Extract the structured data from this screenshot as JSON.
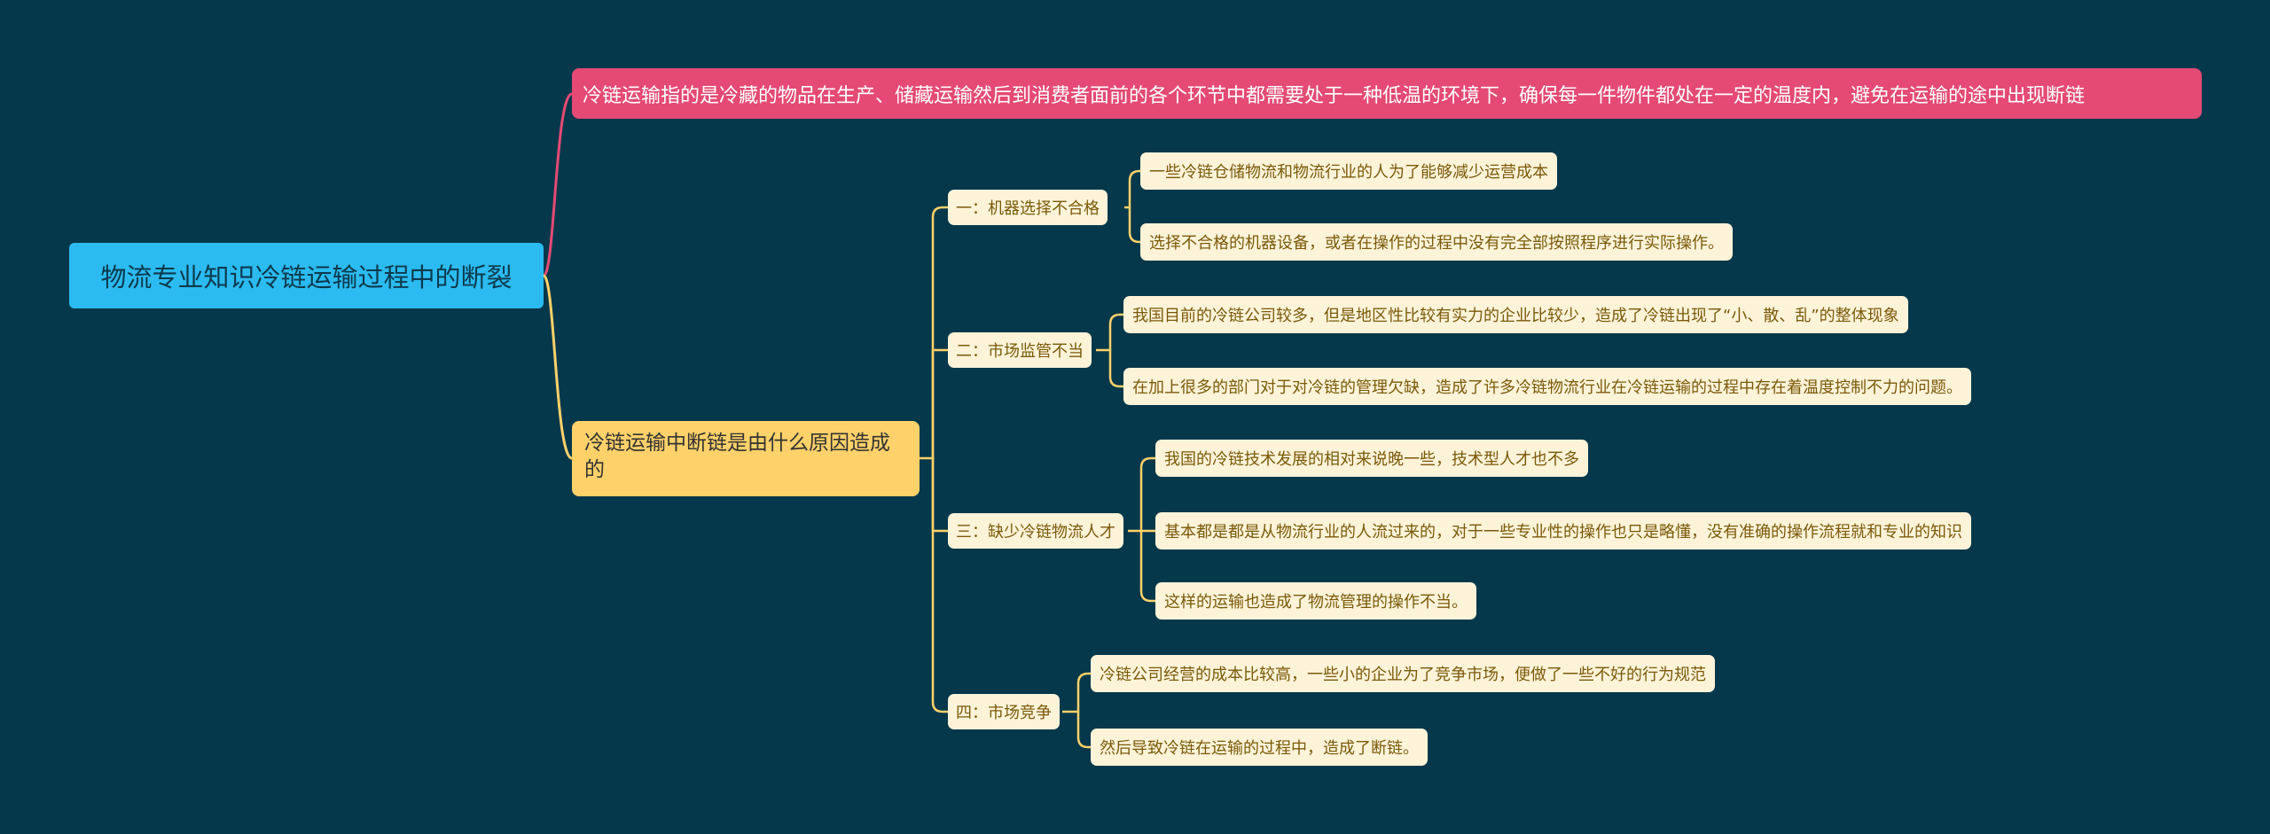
{
  "colors": {
    "background": "#06384b",
    "root": "#2bbbf0",
    "topic_definition": "#e44a74",
    "topic_causes": "#fed16a",
    "leaf": "#fdf3d9",
    "link_pink": "#e44a74",
    "link_yellow": "#fed16a"
  },
  "mindmap": {
    "root": "物流专业知识冷链运输过程中的断裂",
    "definition": "冷链运输指的是冷藏的物品在生产、储藏运输然后到消费者面前的各个环节中都需要处于一种低温的环境下，确保每一件物件都处在一定的温度内，避免在运输的途中出现断链",
    "causes": {
      "title": "冷链运输中断链是由什么原因造成的",
      "branches": [
        {
          "label": "一：机器选择不合格",
          "items": [
            "一些冷链仓储物流和物流行业的人为了能够减少运营成本",
            "选择不合格的机器设备，或者在操作的过程中没有完全部按照程序进行实际操作。"
          ]
        },
        {
          "label": "二：市场监管不当",
          "items": [
            "我国目前的冷链公司较多，但是地区性比较有实力的企业比较少，造成了冷链出现了“小、散、乱”的整体现象",
            "在加上很多的部门对于对冷链的管理欠缺，造成了许多冷链物流行业在冷链运输的过程中存在着温度控制不力的问题。"
          ]
        },
        {
          "label": "三：缺少冷链物流人才",
          "items": [
            "我国的冷链技术发展的相对来说晚一些，技术型人才也不多",
            "基本都是都是从物流行业的人流过来的，对于一些专业性的操作也只是略懂，没有准确的操作流程就和专业的知识",
            "这样的运输也造成了物流管理的操作不当。"
          ]
        },
        {
          "label": "四：市场竞争",
          "items": [
            "冷链公司经营的成本比较高，一些小的企业为了竞争市场，便做了一些不好的行为规范",
            "然后导致冷链在运输的过程中，造成了断链。"
          ]
        }
      ]
    }
  }
}
